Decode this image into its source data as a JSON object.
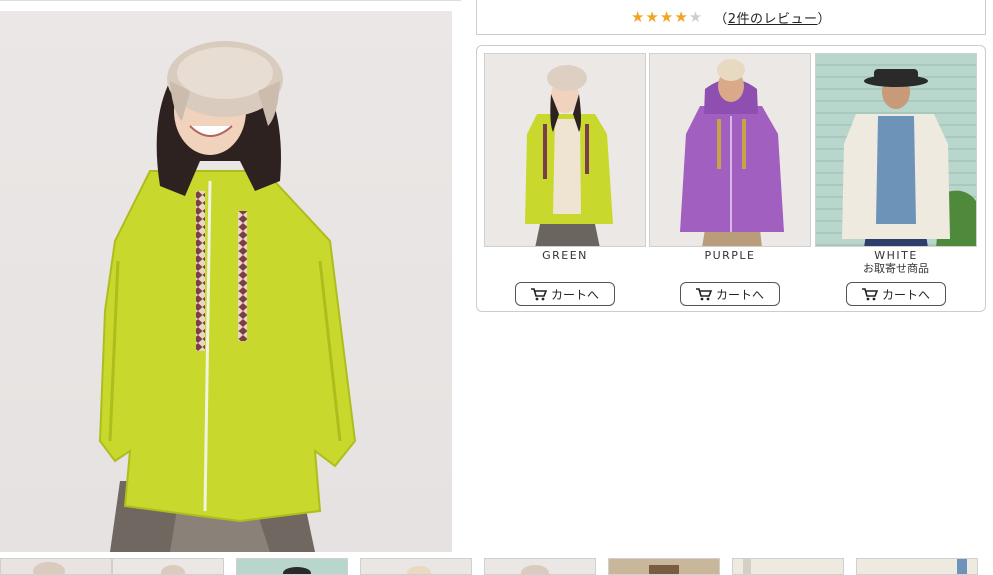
{
  "review": {
    "rating": 4,
    "max_rating": 5,
    "link_open": "（",
    "link_text": "2件のレビュー",
    "link_close": "）"
  },
  "variants": [
    {
      "color": "GREEN",
      "note": "",
      "cart_label": "カートへ"
    },
    {
      "color": "PURPLE",
      "note": "",
      "cart_label": "カートへ"
    },
    {
      "color": "WHITE",
      "note": "お取寄せ商品",
      "cart_label": "カートへ"
    }
  ],
  "colors": {
    "star_on": "#f0a623",
    "star_off": "#cfcfcf",
    "green_hoodie": "#c8d82c",
    "purple_hoodie": "#a15fc0",
    "white_hoodie": "#eeeae0"
  },
  "icons": {
    "cart": "shopping-cart-icon",
    "star": "star-icon"
  },
  "thumbnail_strip_count": 8
}
